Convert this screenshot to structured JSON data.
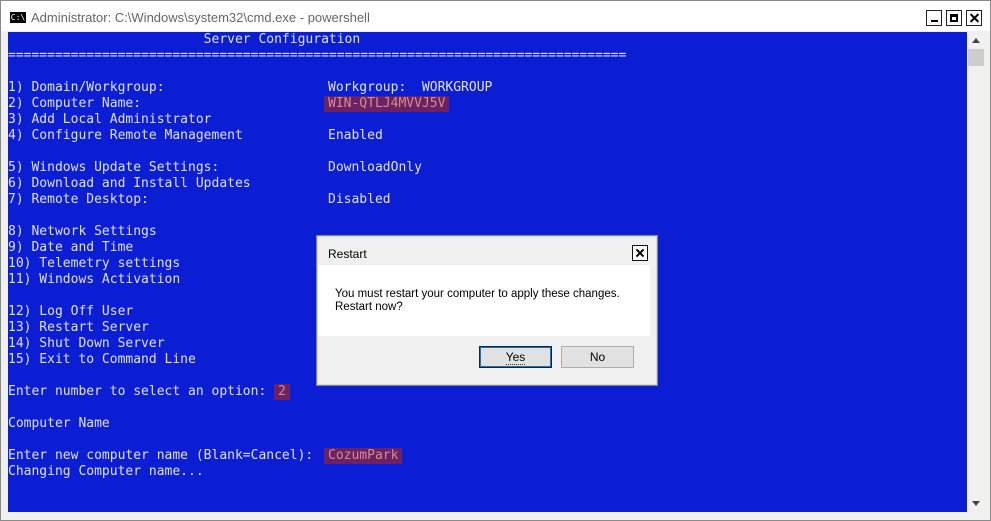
{
  "window": {
    "icon_label": "C:\\",
    "title": "Administrator: C:\\Windows\\system32\\cmd.exe - powershell"
  },
  "console": {
    "lines": [
      "                         Server Configuration",
      "===============================================================================",
      "",
      "1) Domain/Workgroup:",
      "2) Computer Name:",
      "3) Add Local Administrator",
      "4) Configure Remote Management",
      "",
      "5) Windows Update Settings:",
      "6) Download and Install Updates",
      "7) Remote Desktop:",
      "",
      "8) Network Settings",
      "9) Date and Time",
      "10) Telemetry settings",
      "11) Windows Activation",
      "",
      "12) Log Off User",
      "13) Restart Server",
      "14) Shut Down Server",
      "15) Exit to Command Line",
      "",
      "Enter number to select an option:",
      "",
      "Computer Name",
      "",
      "Enter new computer name (Blank=Cancel):",
      "Changing Computer name..."
    ],
    "values": {
      "domain_workgroup": "Workgroup:  WORKGROUP",
      "computer_name": "WIN-QTLJ4MVVJ5V",
      "remote_management": "Enabled",
      "windows_update": "DownloadOnly",
      "remote_desktop": "Disabled"
    },
    "option_input": "2",
    "new_name_input": "CozumPark"
  },
  "dialog": {
    "title": "Restart",
    "message_line1": "You must restart your computer to apply these changes.",
    "message_line2": "Restart now?",
    "yes_label": "Yes",
    "no_label": "No"
  },
  "colors": {
    "console_bg": "#0b1ed3",
    "console_text": "#e0e0e0",
    "highlight_bg": "#6b2164"
  }
}
